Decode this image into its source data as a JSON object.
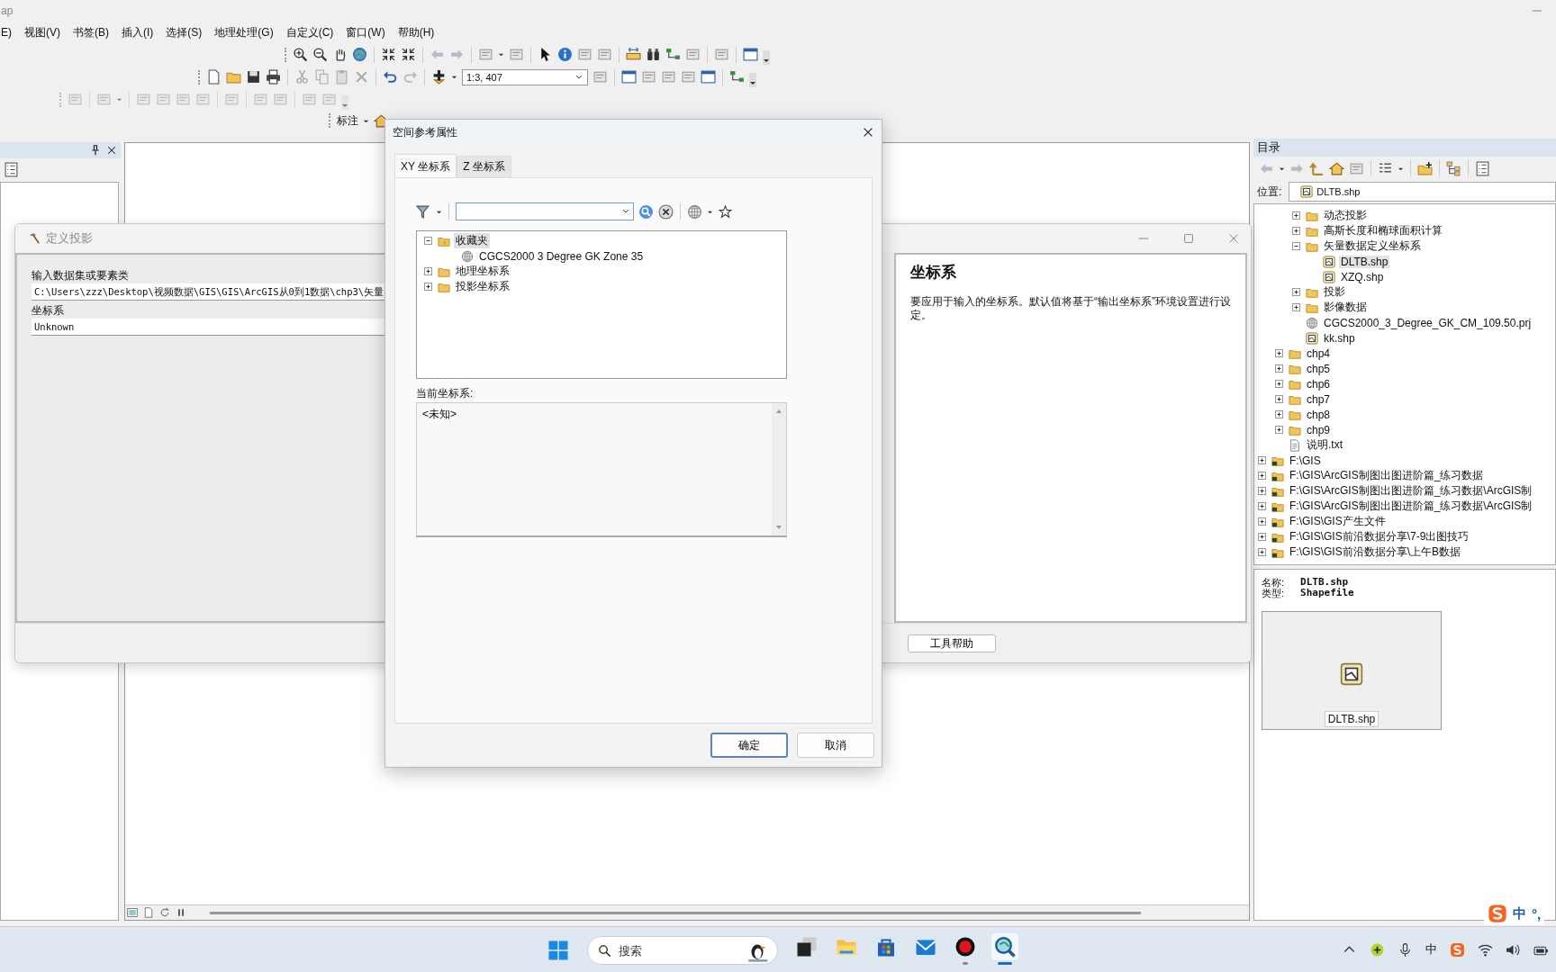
{
  "app": {
    "title": "ap"
  },
  "menu": [
    "E)",
    "视图(V)",
    "书签(B)",
    "插入(I)",
    "选择(S)",
    "地理处理(G)",
    "自定义(C)",
    "窗口(W)",
    "帮助(H)"
  ],
  "scale": "1:3, 407",
  "label_toolbar": "标注",
  "define_projection": {
    "title": "定义投影",
    "fields": [
      {
        "label": "输入数据集或要素类",
        "value": "C:\\Users\\zzz\\Desktop\\视频数据\\GIS\\GIS\\ArcGIS从0到1数据\\chp3\\矢量"
      },
      {
        "label": "坐标系",
        "value": "Unknown"
      }
    ],
    "help": {
      "heading": "坐标系",
      "text": "要应用于输入的坐标系。默认值将基于“输出坐标系”环境设置进行设定。"
    },
    "help_button": "工具帮助"
  },
  "spatial_ref": {
    "title": "空间参考属性",
    "tabs": [
      {
        "label": "XY 坐标系",
        "selected": true
      },
      {
        "label": "Z 坐标系",
        "selected": false
      }
    ],
    "tree": [
      {
        "label": "收藏夹",
        "kind": "favorites",
        "expanded": true,
        "selected": true,
        "children": [
          {
            "label": "CGCS2000 3 Degree GK Zone 35",
            "kind": "globe",
            "selected": false
          }
        ]
      },
      {
        "label": "地理坐标系",
        "kind": "folder",
        "expanded": false,
        "selected": false
      },
      {
        "label": "投影坐标系",
        "kind": "folder",
        "expanded": false,
        "selected": false
      }
    ],
    "current_label": "当前坐标系:",
    "current_value": "<未知>",
    "buttons": [
      {
        "label": "确定",
        "kind": "default"
      },
      {
        "label": "取消",
        "kind": "normal"
      }
    ]
  },
  "catalog": {
    "title": "目录",
    "location_label": "位置:",
    "location": "DLTB.shp",
    "tree": [
      {
        "children": [
          {
            "children": [
              {
                "label": "动态投影",
                "kind": "folder",
                "expanded": false,
                "selected": false
              },
              {
                "label": "高斯长度和椭球面积计算",
                "kind": "folder",
                "expanded": false,
                "selected": false
              },
              {
                "label": "矢量数据定义坐标系",
                "kind": "folder",
                "expanded": true,
                "selected": false,
                "children": [
                  {
                    "label": "DLTB.shp",
                    "kind": "shapefile",
                    "selected": true
                  },
                  {
                    "label": "XZQ.shp",
                    "kind": "shapefile",
                    "selected": false
                  }
                ]
              },
              {
                "label": "投影",
                "kind": "folder",
                "expanded": false,
                "selected": false
              },
              {
                "label": "影像数据",
                "kind": "folder",
                "expanded": false,
                "selected": false
              },
              {
                "label": "CGCS2000_3_Degree_GK_CM_109.50.prj",
                "kind": "globe",
                "selected": false
              },
              {
                "label": "kk.shp",
                "kind": "shapefile",
                "selected": false
              }
            ]
          },
          {
            "label": "chp4",
            "kind": "folder",
            "expanded": false,
            "selected": false
          },
          {
            "label": "chp5",
            "kind": "folder",
            "expanded": false,
            "selected": false
          },
          {
            "label": "chp6",
            "kind": "folder",
            "expanded": false,
            "selected": false
          },
          {
            "label": "chp7",
            "kind": "folder",
            "expanded": false,
            "selected": false
          },
          {
            "label": "chp8",
            "kind": "folder",
            "expanded": false,
            "selected": false
          },
          {
            "label": "chp9",
            "kind": "folder",
            "expanded": false,
            "selected": false
          },
          {
            "label": "说明.txt",
            "kind": "text",
            "selected": false
          }
        ]
      },
      {
        "label": "F:\\GIS",
        "kind": "connection",
        "expanded": false,
        "selected": false
      },
      {
        "label": "F:\\GIS\\ArcGIS制图出图进阶篇_练习数据",
        "kind": "connection",
        "expanded": false,
        "selected": false
      },
      {
        "label": "F:\\GIS\\ArcGIS制图出图进阶篇_练习数据\\ArcGIS制",
        "kind": "connection",
        "expanded": false,
        "selected": false
      },
      {
        "label": "F:\\GIS\\ArcGIS制图出图进阶篇_练习数据\\ArcGIS制",
        "kind": "connection",
        "expanded": false,
        "selected": false
      },
      {
        "label": "F:\\GIS\\GIS产生文件",
        "kind": "connection",
        "expanded": false,
        "selected": false
      },
      {
        "label": "F:\\GIS\\GIS前沿数据分享\\7-9出图技巧",
        "kind": "connection",
        "expanded": false,
        "selected": false
      },
      {
        "label": "F:\\GIS\\GIS前沿数据分享\\上午B数据",
        "kind": "connection",
        "expanded": false,
        "selected": false
      }
    ],
    "info": {
      "rows": [
        {
          "label": "名称:",
          "value": "DLTB.shp"
        },
        {
          "label": "类型:",
          "value": "Shapefile"
        }
      ],
      "thumbnail_label": "DLTB.shp"
    }
  },
  "taskbar": {
    "search_placeholder": "搜索",
    "apps": [
      {
        "kind": "taskview",
        "open": false,
        "active": false
      },
      {
        "kind": "explorer",
        "open": false,
        "active": false
      },
      {
        "kind": "store",
        "open": false,
        "active": false
      },
      {
        "kind": "mail",
        "open": false,
        "active": false
      },
      {
        "kind": "recorder",
        "open": true,
        "active": false
      },
      {
        "kind": "arcmap",
        "open": true,
        "active": true
      }
    ],
    "ime": "中"
  },
  "ime_bar": {
    "mode": "中",
    "punct": "°,"
  }
}
